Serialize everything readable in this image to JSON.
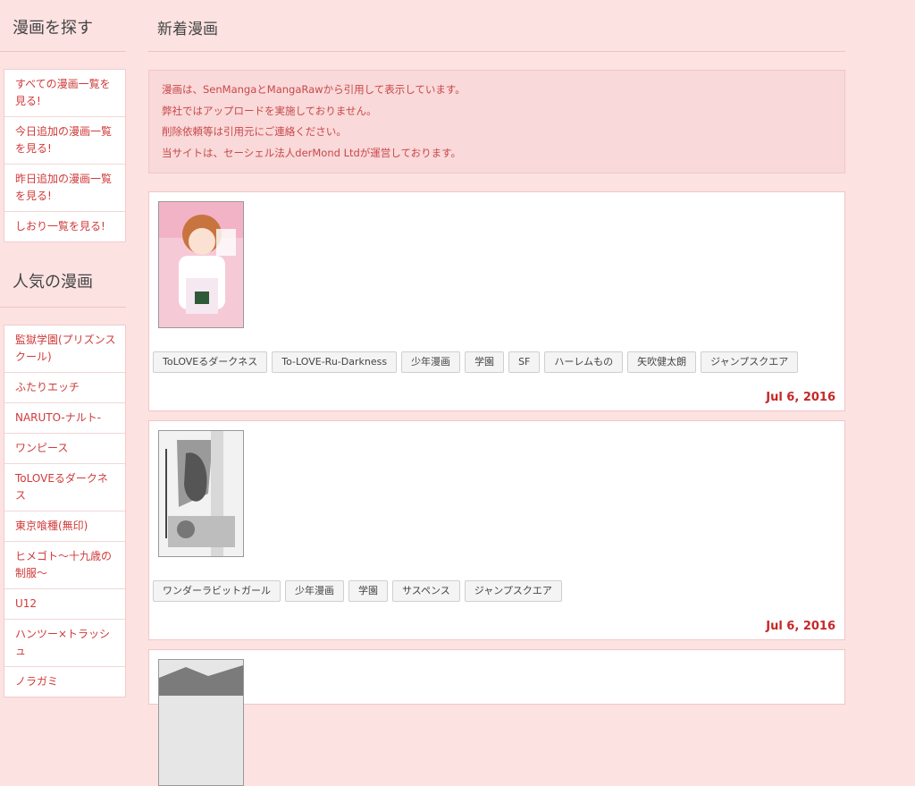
{
  "sidebar": {
    "browse_heading": "漫画を探す",
    "browse_items": [
      {
        "label": "すべての漫画一覧を見る!"
      },
      {
        "label": "今日追加の漫画一覧を見る!"
      },
      {
        "label": "昨日追加の漫画一覧を見る!"
      },
      {
        "label": "しおり一覧を見る!"
      }
    ],
    "popular_heading": "人気の漫画",
    "popular_items": [
      {
        "label": "監獄学園(プリズンスクール)"
      },
      {
        "label": "ふたりエッチ"
      },
      {
        "label": "NARUTO-ナルト-"
      },
      {
        "label": "ワンピース"
      },
      {
        "label": "ToLOVEるダークネス"
      },
      {
        "label": "東京喰種(無印)"
      },
      {
        "label": "ヒメゴト〜十九歳の制服〜"
      },
      {
        "label": "U12"
      },
      {
        "label": "ハンツー×トラッシュ"
      },
      {
        "label": "ノラガミ"
      }
    ]
  },
  "main": {
    "heading": "新着漫画",
    "notice_lines": [
      "漫画は、SenMangaとMangaRawから引用して表示しています。",
      "弊社ではアップロードを実施しておりません。",
      "削除依頼等は引用元にご連絡ください。",
      "当サイトは、セーシェル法人derMond Ltdが運営しております。"
    ],
    "cards": [
      {
        "tags": [
          "ToLOVEるダークネス",
          "To-LOVE-Ru-Darkness",
          "少年漫画",
          "学園",
          "SF",
          "ハーレムもの",
          "矢吹健太朗",
          "ジャンプスクエア"
        ],
        "date": "Jul 6, 2016"
      },
      {
        "tags": [
          "ワンダーラビットガール",
          "少年漫画",
          "学園",
          "サスペンス",
          "ジャンプスクエア"
        ],
        "date": "Jul 6, 2016"
      }
    ]
  },
  "colors": {
    "background": "#fde2e2",
    "link": "#d03a3a",
    "date": "#c42828"
  }
}
